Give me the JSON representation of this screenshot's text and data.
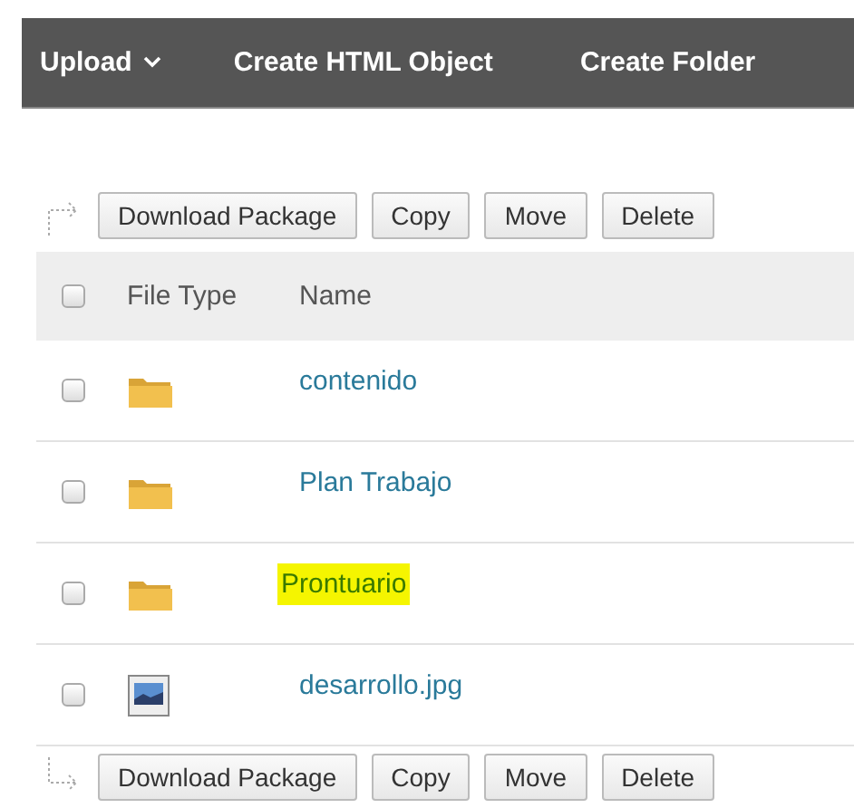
{
  "toolbar": {
    "items": [
      {
        "label": "Upload",
        "kind": "menu"
      },
      {
        "label": "Create HTML Object",
        "kind": "action"
      },
      {
        "label": "Create Folder",
        "kind": "action"
      }
    ]
  },
  "top_actions": [
    "Download Package",
    "Copy",
    "Move",
    "Delete"
  ],
  "table": {
    "select_all": {
      "checked": false
    },
    "columns": [
      "File Type",
      "Name"
    ],
    "rows": [
      {
        "kind": "folder",
        "name": "contenido",
        "checked": false,
        "highlighted": false
      },
      {
        "kind": "folder",
        "name": "Plan Trabajo",
        "checked": false,
        "highlighted": false
      },
      {
        "kind": "folder",
        "name": "Prontuario",
        "checked": false,
        "highlighted": true
      },
      {
        "kind": "image",
        "name": "desarrollo.jpg",
        "checked": false,
        "highlighted": false
      }
    ]
  },
  "bottom_actions": [
    "Download Package",
    "Copy",
    "Move",
    "Delete"
  ]
}
